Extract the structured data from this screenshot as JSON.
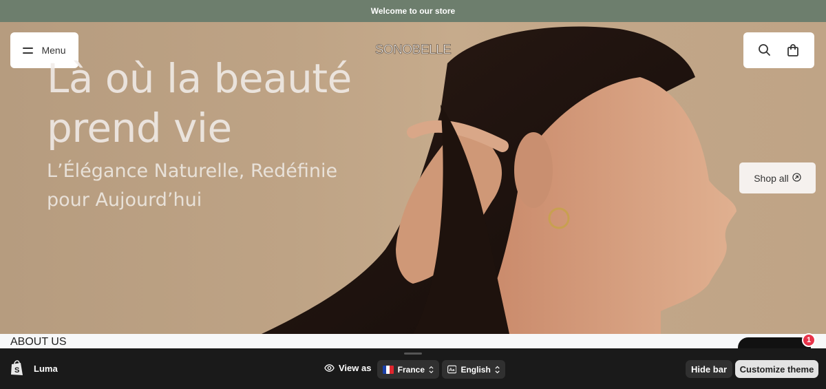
{
  "announcement": {
    "text": "Welcome to our store"
  },
  "header": {
    "menu_label": "Menu",
    "logo_text": "SONOBELLE",
    "search_icon": "search-icon",
    "cart_icon": "shopping-bag-icon"
  },
  "hero": {
    "headline_line1": "Là où la beauté",
    "headline_line2": "prend vie",
    "subtitle_line1": "L’Élégance Naturelle, Redéfinie",
    "subtitle_line2": "pour Aujourd’hui",
    "cta_label": "Shop all",
    "cta_icon": "arrow-circle-icon"
  },
  "section": {
    "about_title": "ABOUT US"
  },
  "chat": {
    "badge_count": "1"
  },
  "admin_bar": {
    "store_name": "Luma",
    "view_as_label": "View as",
    "country": "France",
    "language": "English",
    "hide_bar_label": "Hide bar",
    "customize_label": "Customize theme"
  },
  "colors": {
    "announcement_bg": "#6d7e6d",
    "admin_bar_bg": "#1a1a1a",
    "badge": "#e8334a"
  }
}
